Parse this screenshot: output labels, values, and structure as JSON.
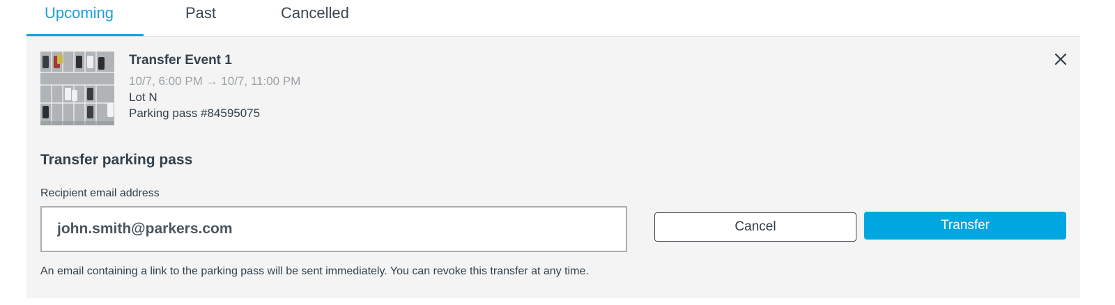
{
  "tabs": [
    {
      "label": "Upcoming",
      "active": true
    },
    {
      "label": "Past",
      "active": false
    },
    {
      "label": "Cancelled",
      "active": false
    }
  ],
  "event": {
    "title": "Transfer Event 1",
    "time": "10/7, 6:00 PM → 10/7, 11:00 PM",
    "lot": "Lot N",
    "pass": "Parking pass #84595075",
    "thumbnail_icon": "parking-lot-aerial-photo"
  },
  "transfer": {
    "title": "Transfer parking pass",
    "email_label": "Recipient email address",
    "email_value": "john.smith@parkers.com",
    "cancel_label": "Cancel",
    "transfer_label": "Transfer",
    "help_text": "An email containing a link to the parking pass will be sent immediately. You can revoke this transfer at any time."
  },
  "icons": {
    "close": "close-icon"
  },
  "colors": {
    "accent": "#1aa0d8",
    "primary_button": "#00a6e0",
    "panel_background": "#f4f4f4",
    "text": "#33414c",
    "muted_text": "#9aa1a7"
  }
}
